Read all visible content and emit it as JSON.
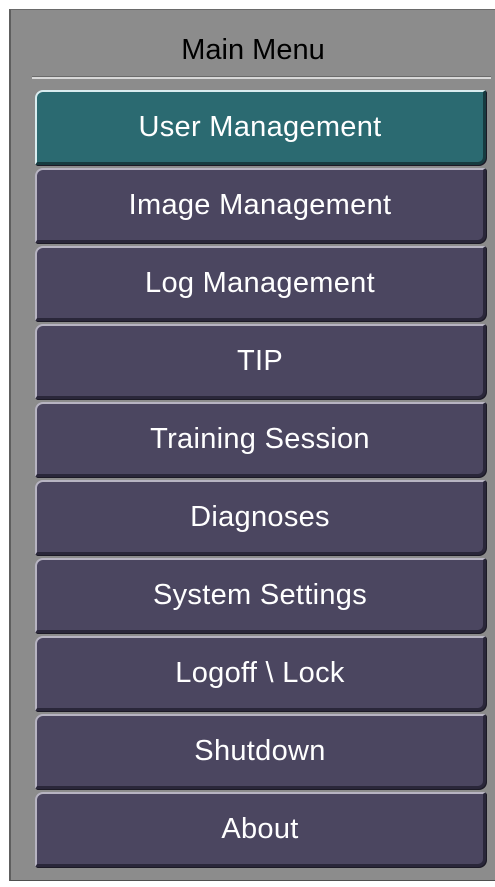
{
  "panel": {
    "title": "Main Menu"
  },
  "menu": {
    "items": [
      {
        "label": "User Management",
        "active": true
      },
      {
        "label": "Image Management",
        "active": false
      },
      {
        "label": "Log Management",
        "active": false
      },
      {
        "label": "TIP",
        "active": false
      },
      {
        "label": "Training Session",
        "active": false
      },
      {
        "label": "Diagnoses",
        "active": false
      },
      {
        "label": "System Settings",
        "active": false
      },
      {
        "label": "Logoff \\ Lock",
        "active": false
      },
      {
        "label": "Shutdown",
        "active": false
      },
      {
        "label": "About",
        "active": false
      }
    ]
  },
  "colors": {
    "panel_background": "#8c8c8c",
    "button_background": "#4b4660",
    "active_button_background": "#2b6a71",
    "button_text": "#ffffff",
    "title_text": "#000000"
  }
}
